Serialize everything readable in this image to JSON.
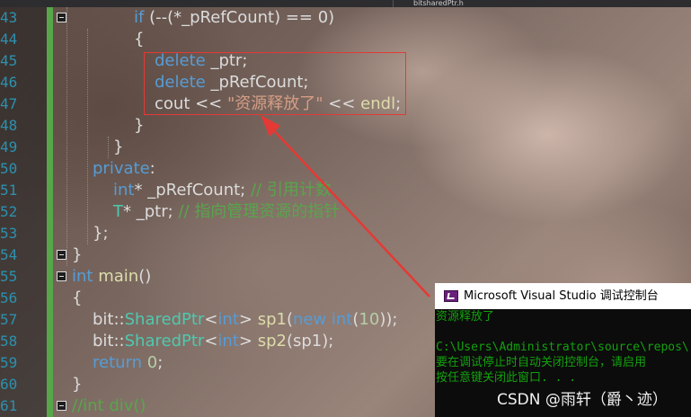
{
  "editor": {
    "tab_fragment": "bitsharedPtr.h",
    "lines": [
      {
        "n": "43",
        "parts": [
          {
            "t": "if ",
            "c": "kw"
          },
          {
            "t": "(--(*_pRefCount) == 0)",
            "c": ""
          }
        ]
      },
      {
        "n": "44",
        "parts": [
          {
            "t": "{",
            "c": ""
          }
        ]
      },
      {
        "n": "45",
        "parts": [
          {
            "t": "delete ",
            "c": "kw"
          },
          {
            "t": "_ptr;",
            "c": ""
          }
        ]
      },
      {
        "n": "46",
        "parts": [
          {
            "t": "delete ",
            "c": "kw"
          },
          {
            "t": "_pRefCount;",
            "c": ""
          }
        ]
      },
      {
        "n": "47",
        "parts": [
          {
            "t": "cout << ",
            "c": ""
          },
          {
            "t": "\"资源释放了\"",
            "c": "str"
          },
          {
            "t": " << ",
            "c": ""
          },
          {
            "t": "endl",
            "c": "fn"
          },
          {
            "t": ";",
            "c": ""
          }
        ]
      },
      {
        "n": "48",
        "parts": [
          {
            "t": "}",
            "c": ""
          }
        ]
      },
      {
        "n": "49",
        "parts": [
          {
            "t": "}",
            "c": ""
          }
        ]
      },
      {
        "n": "50",
        "parts": [
          {
            "t": "private",
            "c": "kw"
          },
          {
            "t": ":",
            "c": ""
          }
        ]
      },
      {
        "n": "51",
        "parts": [
          {
            "t": "int",
            "c": "kw"
          },
          {
            "t": "* _pRefCount; ",
            "c": ""
          },
          {
            "t": "// 引用计数",
            "c": "cm"
          }
        ]
      },
      {
        "n": "52",
        "parts": [
          {
            "t": "T",
            "c": "ty"
          },
          {
            "t": "* _ptr; ",
            "c": ""
          },
          {
            "t": "// 指向管理资源的指针",
            "c": "cm"
          }
        ]
      },
      {
        "n": "53",
        "parts": [
          {
            "t": "};",
            "c": ""
          }
        ]
      },
      {
        "n": "54",
        "parts": [
          {
            "t": "}",
            "c": ""
          }
        ]
      },
      {
        "n": "55",
        "parts": [
          {
            "t": "int ",
            "c": "kw"
          },
          {
            "t": "main",
            "c": "fn"
          },
          {
            "t": "()",
            "c": ""
          }
        ]
      },
      {
        "n": "56",
        "parts": [
          {
            "t": "{",
            "c": ""
          }
        ]
      },
      {
        "n": "57",
        "parts": [
          {
            "t": "bit::",
            "c": ""
          },
          {
            "t": "SharedPtr",
            "c": "ty"
          },
          {
            "t": "<",
            "c": ""
          },
          {
            "t": "int",
            "c": "kw"
          },
          {
            "t": "> ",
            "c": ""
          },
          {
            "t": "sp1",
            "c": "fn"
          },
          {
            "t": "(",
            "c": ""
          },
          {
            "t": "new int",
            "c": "kw"
          },
          {
            "t": "(",
            "c": ""
          },
          {
            "t": "10",
            "c": "num"
          },
          {
            "t": "));",
            "c": ""
          }
        ]
      },
      {
        "n": "58",
        "parts": [
          {
            "t": "bit::",
            "c": ""
          },
          {
            "t": "SharedPtr",
            "c": "ty"
          },
          {
            "t": "<",
            "c": ""
          },
          {
            "t": "int",
            "c": "kw"
          },
          {
            "t": "> ",
            "c": ""
          },
          {
            "t": "sp2",
            "c": "fn"
          },
          {
            "t": "(sp1);",
            "c": ""
          }
        ]
      },
      {
        "n": "59",
        "parts": [
          {
            "t": "return ",
            "c": "kw"
          },
          {
            "t": "0",
            "c": "num"
          },
          {
            "t": ";",
            "c": ""
          }
        ]
      },
      {
        "n": "60",
        "parts": [
          {
            "t": "}",
            "c": ""
          }
        ]
      },
      {
        "n": "61",
        "parts": [
          {
            "t": "//int div()",
            "c": "cm"
          }
        ]
      }
    ]
  },
  "console": {
    "title": "Microsoft Visual Studio 调试控制台",
    "lines": [
      "资源释放了",
      "",
      "C:\\Users\\Administrator\\source\\repos\\",
      "要在调试停止时自动关闭控制台，请启用",
      "按任意键关闭此窗口. . ."
    ]
  },
  "watermark": "CSDN @雨轩（爵丶迹）",
  "colors": {
    "keyword": "#569cd6",
    "type": "#4ec9b0",
    "function": "#dcdcaa",
    "string": "#d69d85",
    "comment": "#57a64a",
    "number": "#b5cea8",
    "line_number": "#2b91af",
    "highlight_box": "#e53935",
    "console_text": "#13a10e"
  }
}
